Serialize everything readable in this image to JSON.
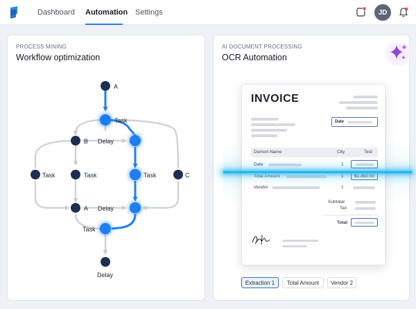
{
  "nav": {
    "items": [
      "Dashboard",
      "Automation",
      "Settings"
    ],
    "active": "Automation"
  },
  "header": {
    "avatar_initials": "JD",
    "icons": [
      "app-logo-icon",
      "notification-icon",
      "bell-icon"
    ]
  },
  "colors": {
    "accent": "#2c7be5",
    "node": "#1e2f52",
    "highlight_node": "#1f7ef0",
    "scan": "#27b6ee",
    "sparkle": "#8e44d8"
  },
  "process_card": {
    "subtitle": "PROCESS MINING",
    "title": "Workflow optimization",
    "nodes": {
      "a_top": "A",
      "task_top": "Task",
      "b": "B",
      "delay_mid": "Delay",
      "task_left": "Task",
      "task_center": "Task",
      "task_right": "Task",
      "c": "C",
      "a_mid": "A",
      "delay_lower": "Delay",
      "task_bottom": "Task",
      "delay_bottom": "Delay"
    }
  },
  "ocr_card": {
    "subtitle": "AI DOCUMENT PROCESSING",
    "title": "OCR Automation",
    "sparkle_icon": "sparkle-icon",
    "invoice": {
      "title": "INVOICE",
      "date_label": "Date",
      "columns": [
        "Domort Name",
        "City",
        "Test"
      ],
      "rows": [
        {
          "label": "Date",
          "qty": "1",
          "value": ""
        },
        {
          "label": "Total Amount",
          "qty": "1",
          "value": "$1,450.00"
        },
        {
          "label": "Vendor",
          "qty": "1",
          "value": ""
        }
      ],
      "subtotal_label": "Subtatal",
      "tax_label": "Tax",
      "total_label": "Total",
      "signature_icon": "signature-icon"
    },
    "chips": [
      {
        "label": "Extraction 1",
        "selected": true
      },
      {
        "label": "Total Amount",
        "selected": false
      },
      {
        "label": "Vendor 2",
        "selected": false
      }
    ]
  }
}
